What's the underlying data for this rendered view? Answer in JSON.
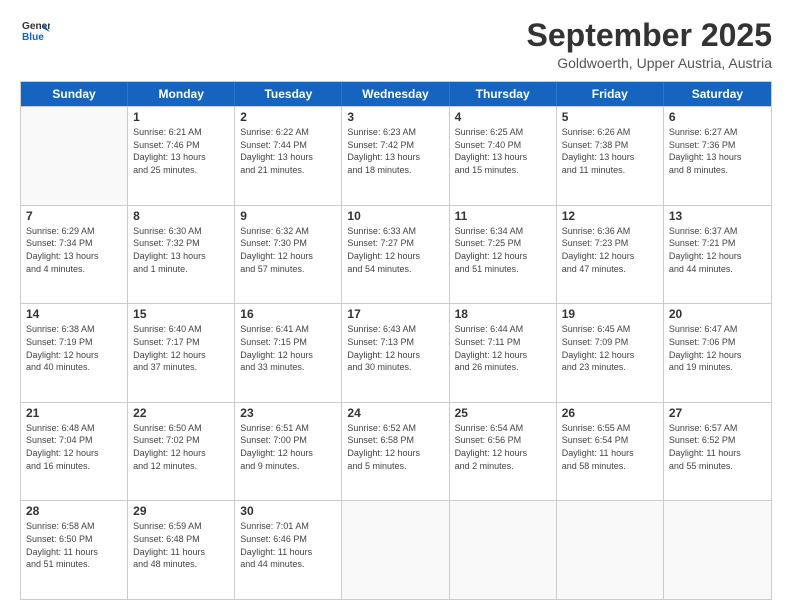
{
  "header": {
    "logo_general": "General",
    "logo_blue": "Blue",
    "month_title": "September 2025",
    "location": "Goldwoerth, Upper Austria, Austria"
  },
  "days_of_week": [
    "Sunday",
    "Monday",
    "Tuesday",
    "Wednesday",
    "Thursday",
    "Friday",
    "Saturday"
  ],
  "weeks": [
    [
      {
        "day": "",
        "info": ""
      },
      {
        "day": "1",
        "info": "Sunrise: 6:21 AM\nSunset: 7:46 PM\nDaylight: 13 hours\nand 25 minutes."
      },
      {
        "day": "2",
        "info": "Sunrise: 6:22 AM\nSunset: 7:44 PM\nDaylight: 13 hours\nand 21 minutes."
      },
      {
        "day": "3",
        "info": "Sunrise: 6:23 AM\nSunset: 7:42 PM\nDaylight: 13 hours\nand 18 minutes."
      },
      {
        "day": "4",
        "info": "Sunrise: 6:25 AM\nSunset: 7:40 PM\nDaylight: 13 hours\nand 15 minutes."
      },
      {
        "day": "5",
        "info": "Sunrise: 6:26 AM\nSunset: 7:38 PM\nDaylight: 13 hours\nand 11 minutes."
      },
      {
        "day": "6",
        "info": "Sunrise: 6:27 AM\nSunset: 7:36 PM\nDaylight: 13 hours\nand 8 minutes."
      }
    ],
    [
      {
        "day": "7",
        "info": "Sunrise: 6:29 AM\nSunset: 7:34 PM\nDaylight: 13 hours\nand 4 minutes."
      },
      {
        "day": "8",
        "info": "Sunrise: 6:30 AM\nSunset: 7:32 PM\nDaylight: 13 hours\nand 1 minute."
      },
      {
        "day": "9",
        "info": "Sunrise: 6:32 AM\nSunset: 7:30 PM\nDaylight: 12 hours\nand 57 minutes."
      },
      {
        "day": "10",
        "info": "Sunrise: 6:33 AM\nSunset: 7:27 PM\nDaylight: 12 hours\nand 54 minutes."
      },
      {
        "day": "11",
        "info": "Sunrise: 6:34 AM\nSunset: 7:25 PM\nDaylight: 12 hours\nand 51 minutes."
      },
      {
        "day": "12",
        "info": "Sunrise: 6:36 AM\nSunset: 7:23 PM\nDaylight: 12 hours\nand 47 minutes."
      },
      {
        "day": "13",
        "info": "Sunrise: 6:37 AM\nSunset: 7:21 PM\nDaylight: 12 hours\nand 44 minutes."
      }
    ],
    [
      {
        "day": "14",
        "info": "Sunrise: 6:38 AM\nSunset: 7:19 PM\nDaylight: 12 hours\nand 40 minutes."
      },
      {
        "day": "15",
        "info": "Sunrise: 6:40 AM\nSunset: 7:17 PM\nDaylight: 12 hours\nand 37 minutes."
      },
      {
        "day": "16",
        "info": "Sunrise: 6:41 AM\nSunset: 7:15 PM\nDaylight: 12 hours\nand 33 minutes."
      },
      {
        "day": "17",
        "info": "Sunrise: 6:43 AM\nSunset: 7:13 PM\nDaylight: 12 hours\nand 30 minutes."
      },
      {
        "day": "18",
        "info": "Sunrise: 6:44 AM\nSunset: 7:11 PM\nDaylight: 12 hours\nand 26 minutes."
      },
      {
        "day": "19",
        "info": "Sunrise: 6:45 AM\nSunset: 7:09 PM\nDaylight: 12 hours\nand 23 minutes."
      },
      {
        "day": "20",
        "info": "Sunrise: 6:47 AM\nSunset: 7:06 PM\nDaylight: 12 hours\nand 19 minutes."
      }
    ],
    [
      {
        "day": "21",
        "info": "Sunrise: 6:48 AM\nSunset: 7:04 PM\nDaylight: 12 hours\nand 16 minutes."
      },
      {
        "day": "22",
        "info": "Sunrise: 6:50 AM\nSunset: 7:02 PM\nDaylight: 12 hours\nand 12 minutes."
      },
      {
        "day": "23",
        "info": "Sunrise: 6:51 AM\nSunset: 7:00 PM\nDaylight: 12 hours\nand 9 minutes."
      },
      {
        "day": "24",
        "info": "Sunrise: 6:52 AM\nSunset: 6:58 PM\nDaylight: 12 hours\nand 5 minutes."
      },
      {
        "day": "25",
        "info": "Sunrise: 6:54 AM\nSunset: 6:56 PM\nDaylight: 12 hours\nand 2 minutes."
      },
      {
        "day": "26",
        "info": "Sunrise: 6:55 AM\nSunset: 6:54 PM\nDaylight: 11 hours\nand 58 minutes."
      },
      {
        "day": "27",
        "info": "Sunrise: 6:57 AM\nSunset: 6:52 PM\nDaylight: 11 hours\nand 55 minutes."
      }
    ],
    [
      {
        "day": "28",
        "info": "Sunrise: 6:58 AM\nSunset: 6:50 PM\nDaylight: 11 hours\nand 51 minutes."
      },
      {
        "day": "29",
        "info": "Sunrise: 6:59 AM\nSunset: 6:48 PM\nDaylight: 11 hours\nand 48 minutes."
      },
      {
        "day": "30",
        "info": "Sunrise: 7:01 AM\nSunset: 6:46 PM\nDaylight: 11 hours\nand 44 minutes."
      },
      {
        "day": "",
        "info": ""
      },
      {
        "day": "",
        "info": ""
      },
      {
        "day": "",
        "info": ""
      },
      {
        "day": "",
        "info": ""
      }
    ]
  ]
}
